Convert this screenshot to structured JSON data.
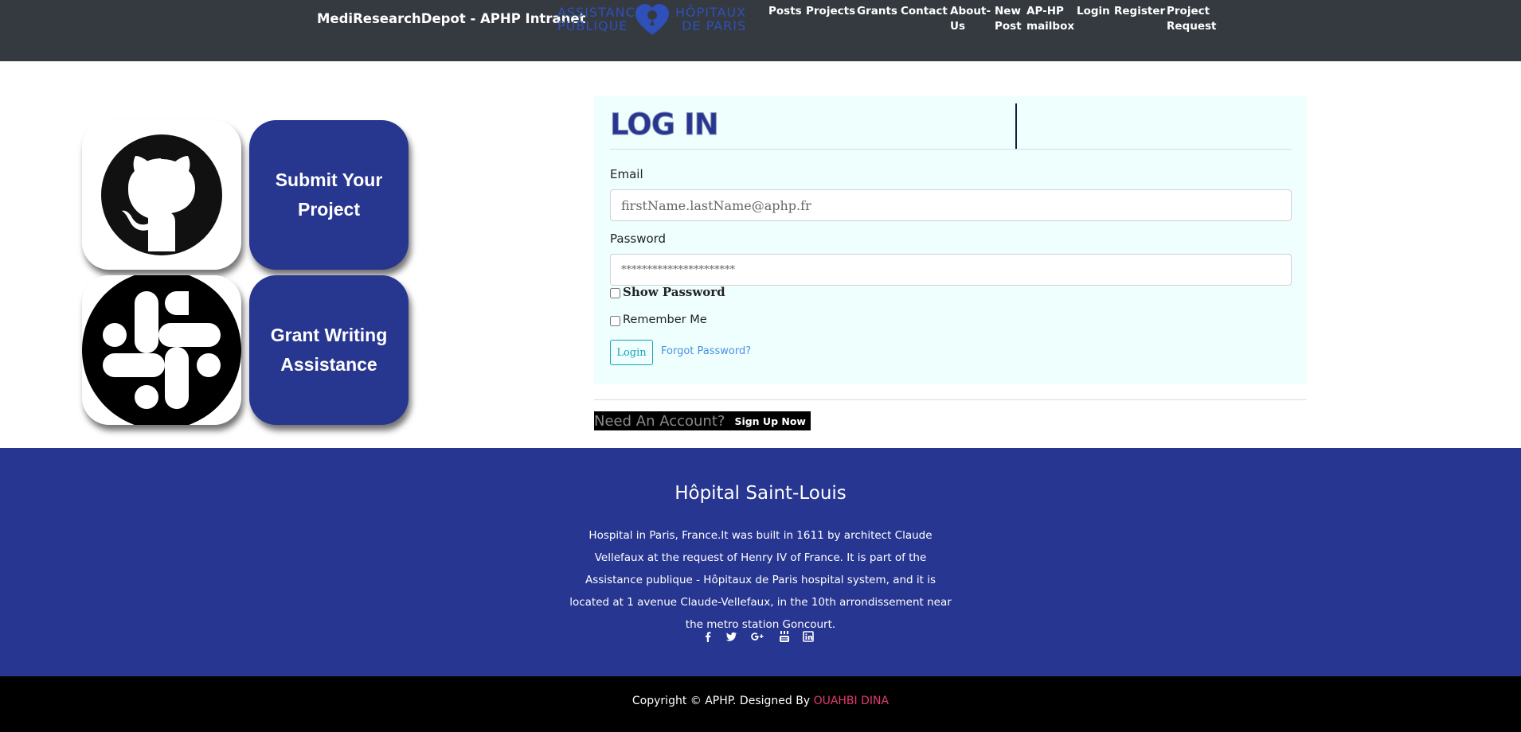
{
  "header": {
    "brand": "MediResearchDepot - APHP Intranet",
    "logo": {
      "left_line1": "ASSISTANCE",
      "left_line2": "PUBLIQUE",
      "right_line1": "HÔPITAUX",
      "right_line2": "DE PARIS"
    },
    "nav": [
      {
        "label": "Posts"
      },
      {
        "label": "Projects"
      },
      {
        "label": "Grants"
      },
      {
        "label": "Contact"
      },
      {
        "label1": "About-",
        "label2": "Us"
      },
      {
        "label1": "New",
        "label2": "Post"
      },
      {
        "label1": "AP-HP",
        "label2": "mailbox"
      },
      {
        "label": "Login"
      },
      {
        "label": "Register"
      },
      {
        "label1": "Project",
        "label2": "Request"
      }
    ]
  },
  "tiles": {
    "submit_project": "Submit Your Project",
    "grant_writing": "Grant Writing Assistance",
    "github_icon": "github-icon",
    "slack_icon": "slack-icon"
  },
  "login": {
    "title": "LOG IN",
    "email_label": "Email",
    "email_placeholder": "firstName.lastName@aphp.fr",
    "password_label": "Password",
    "password_placeholder": "**********************",
    "show_password": "Show Password",
    "remember_me": "Remember Me",
    "login_button": "Login",
    "forgot_password": "Forgot Password?",
    "need_account": "Need An Account?",
    "sign_up": "Sign Up Now"
  },
  "footer": {
    "title": "Hôpital Saint-Louis",
    "description": "Hospital in Paris, France.It was built in 1611 by architect Claude Vellefaux at the request of Henry IV of France. It is part of the Assistance publique - Hôpitaux de Paris hospital system, and it is located at 1 avenue Claude-Vellefaux, in the 10th arrondissement near the metro station Goncourt.",
    "socials": [
      "facebook-icon",
      "twitter-icon",
      "google-plus-icon",
      "youtube-icon",
      "linkedin-icon"
    ]
  },
  "copyright": {
    "text": "Copyright © APHP. Designed By",
    "designer": "OUAHBI DINA"
  },
  "colors": {
    "navbar": "#343a40",
    "brand_blue": "#27368f",
    "card_bg": "#eefffe",
    "accent_teal": "#17a2b8",
    "designer_pink": "#e23a6e"
  }
}
